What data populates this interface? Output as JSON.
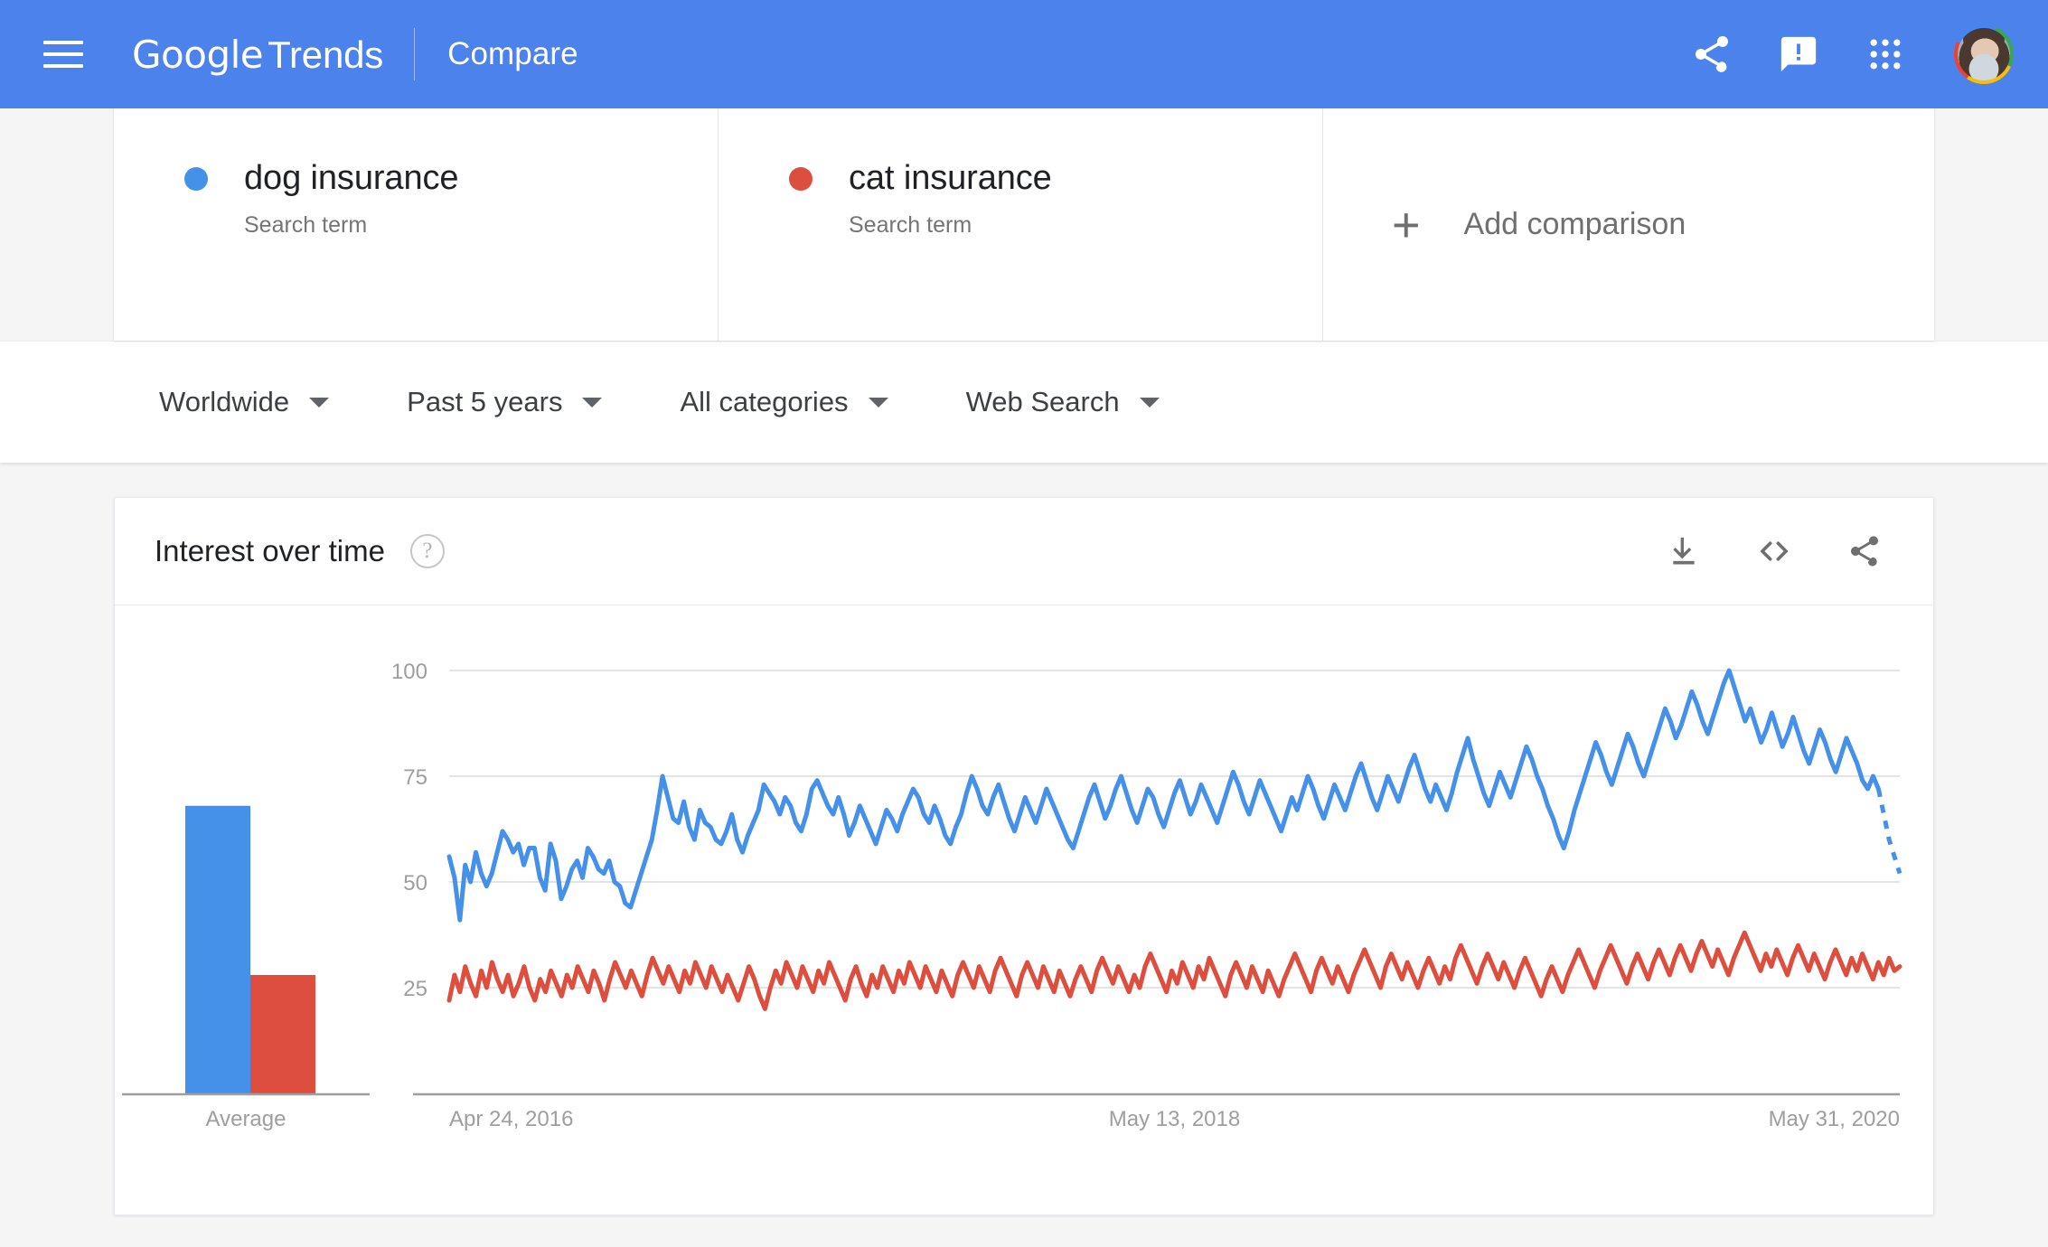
{
  "header": {
    "menu_icon": "hamburger-menu-icon",
    "logo_google": "Google",
    "logo_trends": "Trends",
    "section": "Compare",
    "icons": {
      "share": "share-icon",
      "feedback": "feedback-icon",
      "apps": "apps-grid-icon",
      "avatar": "user-avatar"
    }
  },
  "terms": [
    {
      "label": "dog insurance",
      "sublabel": "Search term",
      "color": "#4591ea"
    },
    {
      "label": "cat insurance",
      "sublabel": "Search term",
      "color": "#de4e3e"
    }
  ],
  "add_comparison": {
    "plus": "+",
    "label": "Add comparison"
  },
  "filters": [
    {
      "label": "Worldwide"
    },
    {
      "label": "Past 5 years"
    },
    {
      "label": "All categories"
    },
    {
      "label": "Web Search"
    }
  ],
  "card": {
    "title": "Interest over time",
    "help": "?",
    "actions": [
      {
        "name": "download-icon"
      },
      {
        "name": "embed-code-icon"
      },
      {
        "name": "share-icon"
      }
    ]
  },
  "chart_data": {
    "type": "line",
    "title": "Interest over time",
    "xlabel": "",
    "ylabel": "",
    "ylim": [
      0,
      100
    ],
    "yticks": [
      25,
      50,
      75,
      100
    ],
    "ytick_labels": [
      "25",
      "50",
      "75",
      "100"
    ],
    "grid": true,
    "legend": [
      "dog insurance",
      "cat insurance"
    ],
    "legend_position": "top-cards",
    "x_tick_labels": [
      "Apr 24, 2016",
      "May 13, 2018",
      "May 31, 2020"
    ],
    "x_tick_positions": [
      0,
      0.5,
      1.0
    ],
    "x_start": "Apr 24, 2016",
    "x_end": "Apr 2021",
    "partial_last_points": 4,
    "average_panel": {
      "label": "Average",
      "values": [
        68,
        28
      ]
    },
    "series": [
      {
        "name": "dog insurance",
        "color": "#4591ea",
        "values": [
          56,
          51,
          41,
          54,
          50,
          57,
          52,
          49,
          52,
          57,
          62,
          60,
          57,
          59,
          54,
          58,
          58,
          51,
          48,
          59,
          55,
          46,
          49,
          53,
          55,
          51,
          58,
          56,
          53,
          52,
          55,
          50,
          49,
          45,
          44,
          48,
          52,
          56,
          60,
          67,
          75,
          70,
          65,
          64,
          69,
          63,
          60,
          67,
          64,
          63,
          60,
          59,
          62,
          66,
          60,
          57,
          61,
          64,
          67,
          73,
          71,
          69,
          66,
          70,
          68,
          64,
          62,
          66,
          72,
          74,
          71,
          68,
          66,
          70,
          66,
          61,
          64,
          68,
          65,
          62,
          59,
          63,
          67,
          65,
          62,
          66,
          69,
          72,
          70,
          66,
          64,
          68,
          65,
          61,
          59,
          63,
          66,
          71,
          75,
          72,
          68,
          66,
          70,
          73,
          69,
          65,
          62,
          66,
          70,
          67,
          64,
          68,
          72,
          69,
          66,
          63,
          60,
          58,
          62,
          66,
          70,
          73,
          69,
          65,
          68,
          72,
          75,
          71,
          67,
          64,
          68,
          72,
          70,
          66,
          63,
          67,
          71,
          74,
          70,
          66,
          69,
          73,
          70,
          67,
          64,
          68,
          72,
          76,
          73,
          69,
          66,
          70,
          74,
          71,
          68,
          65,
          62,
          66,
          70,
          67,
          71,
          75,
          72,
          68,
          65,
          69,
          73,
          70,
          67,
          71,
          75,
          78,
          74,
          70,
          67,
          71,
          75,
          72,
          69,
          73,
          77,
          80,
          76,
          72,
          69,
          73,
          70,
          67,
          71,
          76,
          80,
          84,
          79,
          75,
          71,
          68,
          72,
          76,
          73,
          70,
          74,
          78,
          82,
          79,
          75,
          72,
          68,
          65,
          61,
          58,
          62,
          67,
          71,
          75,
          79,
          83,
          80,
          76,
          73,
          77,
          81,
          85,
          82,
          78,
          75,
          79,
          83,
          87,
          91,
          88,
          84,
          87,
          91,
          95,
          92,
          88,
          85,
          89,
          93,
          97,
          100,
          96,
          92,
          88,
          91,
          87,
          83,
          86,
          90,
          86,
          82,
          85,
          89,
          85,
          81,
          78,
          82,
          86,
          83,
          79,
          76,
          80,
          84,
          81,
          78,
          74,
          72,
          75,
          72,
          66,
          60,
          56,
          52
        ]
      },
      {
        "name": "cat insurance",
        "color": "#de4e3e",
        "values": [
          22,
          28,
          24,
          30,
          26,
          23,
          29,
          25,
          31,
          27,
          24,
          28,
          23,
          26,
          30,
          25,
          22,
          27,
          24,
          29,
          26,
          23,
          28,
          25,
          30,
          27,
          24,
          29,
          26,
          22,
          27,
          31,
          28,
          25,
          29,
          26,
          23,
          28,
          32,
          29,
          26,
          30,
          27,
          24,
          29,
          26,
          31,
          28,
          25,
          30,
          27,
          24,
          28,
          25,
          22,
          26,
          30,
          27,
          23,
          20,
          25,
          29,
          26,
          31,
          28,
          25,
          30,
          27,
          24,
          29,
          26,
          31,
          28,
          25,
          22,
          27,
          30,
          26,
          23,
          28,
          25,
          30,
          27,
          24,
          29,
          26,
          31,
          28,
          25,
          30,
          27,
          24,
          29,
          26,
          23,
          28,
          31,
          28,
          25,
          30,
          27,
          24,
          29,
          32,
          29,
          26,
          23,
          28,
          31,
          28,
          25,
          30,
          27,
          24,
          29,
          26,
          23,
          27,
          30,
          27,
          24,
          29,
          32,
          29,
          26,
          30,
          27,
          24,
          28,
          25,
          30,
          33,
          30,
          27,
          24,
          29,
          26,
          31,
          28,
          25,
          30,
          27,
          32,
          29,
          26,
          23,
          28,
          31,
          28,
          25,
          30,
          27,
          24,
          29,
          26,
          23,
          27,
          30,
          33,
          30,
          27,
          24,
          29,
          32,
          29,
          26,
          30,
          27,
          24,
          28,
          31,
          34,
          31,
          28,
          25,
          30,
          33,
          30,
          27,
          31,
          28,
          25,
          29,
          32,
          29,
          26,
          30,
          27,
          32,
          35,
          32,
          29,
          26,
          30,
          33,
          30,
          27,
          31,
          28,
          25,
          29,
          32,
          29,
          26,
          23,
          27,
          30,
          27,
          24,
          28,
          31,
          34,
          31,
          28,
          25,
          29,
          32,
          35,
          32,
          29,
          26,
          30,
          33,
          30,
          27,
          31,
          34,
          31,
          28,
          32,
          35,
          32,
          29,
          33,
          36,
          33,
          30,
          34,
          31,
          28,
          32,
          35,
          38,
          35,
          32,
          29,
          33,
          30,
          34,
          31,
          28,
          32,
          35,
          32,
          29,
          33,
          30,
          27,
          31,
          34,
          31,
          28,
          32,
          29,
          33,
          30,
          27,
          31,
          28,
          32,
          29,
          30
        ]
      }
    ]
  }
}
